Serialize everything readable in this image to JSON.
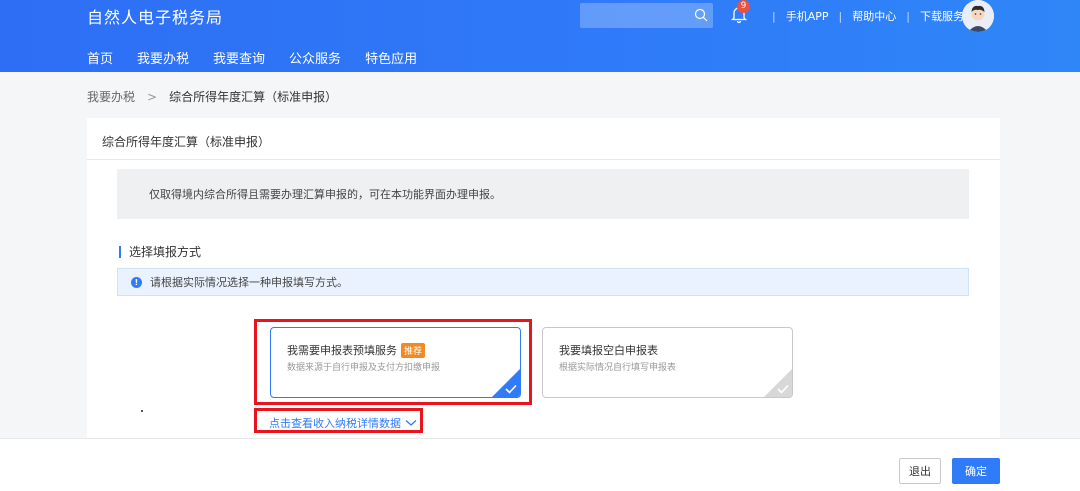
{
  "header": {
    "brand": "自然人电子税务局",
    "nav": [
      "首页",
      "我要办税",
      "我要查询",
      "公众服务",
      "特色应用"
    ],
    "notification_count": "9",
    "links": [
      "手机APP",
      "帮助中心",
      "下载服务"
    ]
  },
  "breadcrumb": {
    "parent": "我要办税",
    "arrow": ">",
    "current": "综合所得年度汇算（标准申报）"
  },
  "card": {
    "title": "综合所得年度汇算（标准申报）",
    "notice": "仅取得境内综合所得且需要办理汇算申报的，可在本功能界面办理申报。",
    "section_title": "选择填报方式",
    "tip": "请根据实际情况选择一种申报填写方式。",
    "options": [
      {
        "title": "我需要申报表预填服务",
        "badge": "推荐",
        "desc": "数据来源于自行申报及支付方扣缴申报",
        "selected": true
      },
      {
        "title": "我要填报空白申报表",
        "desc": "根据实际情况自行填写申报表",
        "selected": false
      }
    ],
    "detail_link": "点击查看收入纳税详情数据"
  },
  "footer": {
    "exit_label": "退出",
    "confirm_label": "确定"
  },
  "colors": {
    "primary": "#2f7bf8",
    "highlight": "#e8141e",
    "badge": "#f08a24"
  }
}
